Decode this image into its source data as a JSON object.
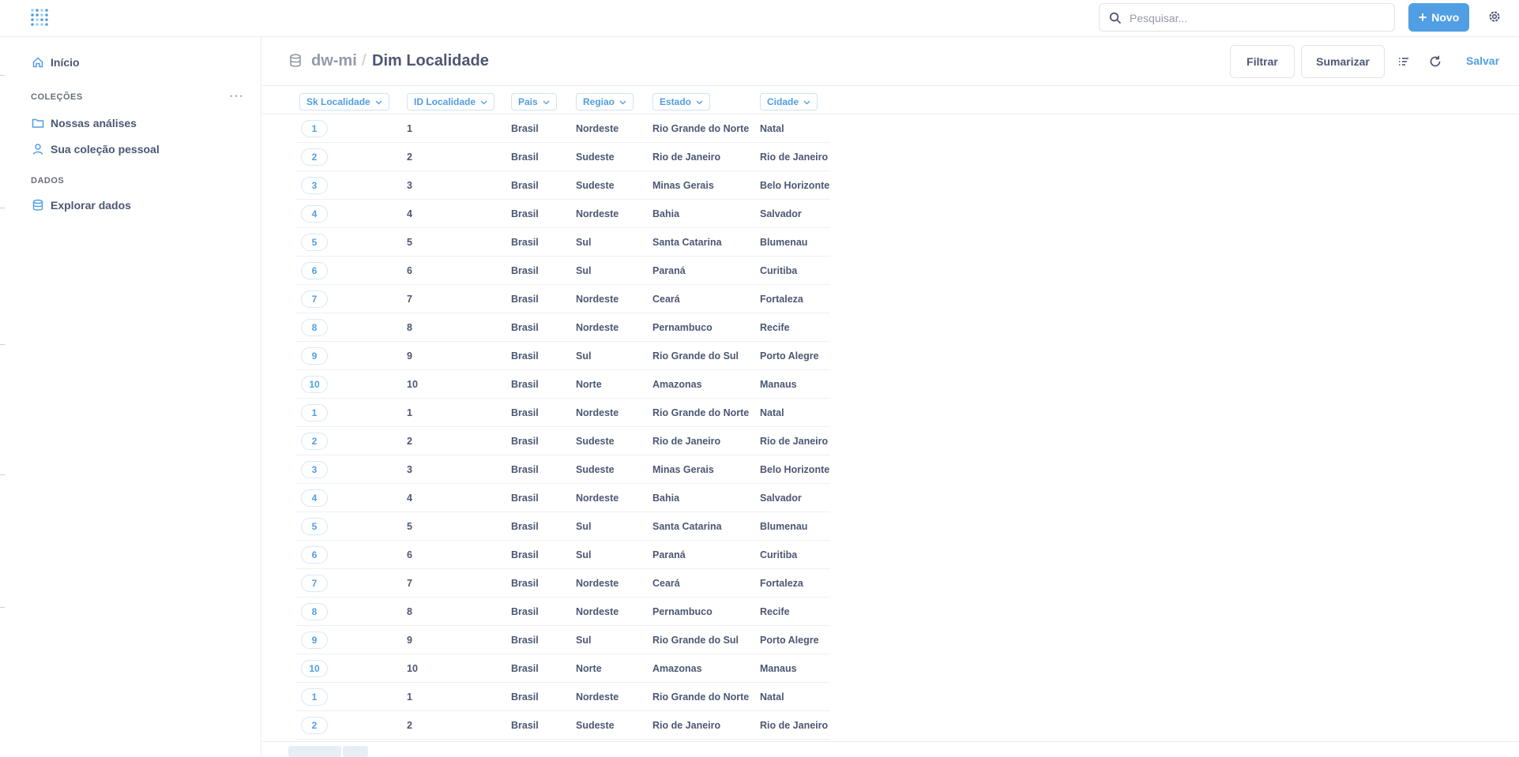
{
  "topbar": {
    "search_placeholder": "Pesquisar...",
    "new_button": "Novo"
  },
  "sidebar": {
    "home": "Início",
    "collections_label": "COLEÇÕES",
    "collections": [
      "Nossas análises",
      "Sua coleção pessoal"
    ],
    "data_label": "DADOS",
    "explore": "Explorar dados"
  },
  "header": {
    "database": "dw-mi",
    "separator": "/",
    "title": "Dim Localidade",
    "filter_button": "Filtrar",
    "summarize_button": "Sumarizar",
    "save_link": "Salvar"
  },
  "table": {
    "columns": [
      "Sk Localidade",
      "ID Localidade",
      "Pais",
      "Regiao",
      "Estado",
      "Cidade"
    ],
    "rows": [
      [
        "1",
        "1",
        "Brasil",
        "Nordeste",
        "Rio Grande do Norte",
        "Natal"
      ],
      [
        "2",
        "2",
        "Brasil",
        "Sudeste",
        "Rio de Janeiro",
        "Rio de Janeiro"
      ],
      [
        "3",
        "3",
        "Brasil",
        "Sudeste",
        "Minas Gerais",
        "Belo Horizonte"
      ],
      [
        "4",
        "4",
        "Brasil",
        "Nordeste",
        "Bahia",
        "Salvador"
      ],
      [
        "5",
        "5",
        "Brasil",
        "Sul",
        "Santa Catarina",
        "Blumenau"
      ],
      [
        "6",
        "6",
        "Brasil",
        "Sul",
        "Paraná",
        "Curitiba"
      ],
      [
        "7",
        "7",
        "Brasil",
        "Nordeste",
        "Ceará",
        "Fortaleza"
      ],
      [
        "8",
        "8",
        "Brasil",
        "Nordeste",
        "Pernambuco",
        "Recife"
      ],
      [
        "9",
        "9",
        "Brasil",
        "Sul",
        "Rio Grande do Sul",
        "Porto Alegre"
      ],
      [
        "10",
        "10",
        "Brasil",
        "Norte",
        "Amazonas",
        "Manaus"
      ],
      [
        "1",
        "1",
        "Brasil",
        "Nordeste",
        "Rio Grande do Norte",
        "Natal"
      ],
      [
        "2",
        "2",
        "Brasil",
        "Sudeste",
        "Rio de Janeiro",
        "Rio de Janeiro"
      ],
      [
        "3",
        "3",
        "Brasil",
        "Sudeste",
        "Minas Gerais",
        "Belo Horizonte"
      ],
      [
        "4",
        "4",
        "Brasil",
        "Nordeste",
        "Bahia",
        "Salvador"
      ],
      [
        "5",
        "5",
        "Brasil",
        "Sul",
        "Santa Catarina",
        "Blumenau"
      ],
      [
        "6",
        "6",
        "Brasil",
        "Sul",
        "Paraná",
        "Curitiba"
      ],
      [
        "7",
        "7",
        "Brasil",
        "Nordeste",
        "Ceará",
        "Fortaleza"
      ],
      [
        "8",
        "8",
        "Brasil",
        "Nordeste",
        "Pernambuco",
        "Recife"
      ],
      [
        "9",
        "9",
        "Brasil",
        "Sul",
        "Rio Grande do Sul",
        "Porto Alegre"
      ],
      [
        "10",
        "10",
        "Brasil",
        "Norte",
        "Amazonas",
        "Manaus"
      ],
      [
        "1",
        "1",
        "Brasil",
        "Nordeste",
        "Rio Grande do Norte",
        "Natal"
      ],
      [
        "2",
        "2",
        "Brasil",
        "Sudeste",
        "Rio de Janeiro",
        "Rio de Janeiro"
      ]
    ]
  },
  "colors": {
    "accent": "#509ee3",
    "text": "#4c5773",
    "muted": "#949aab"
  }
}
